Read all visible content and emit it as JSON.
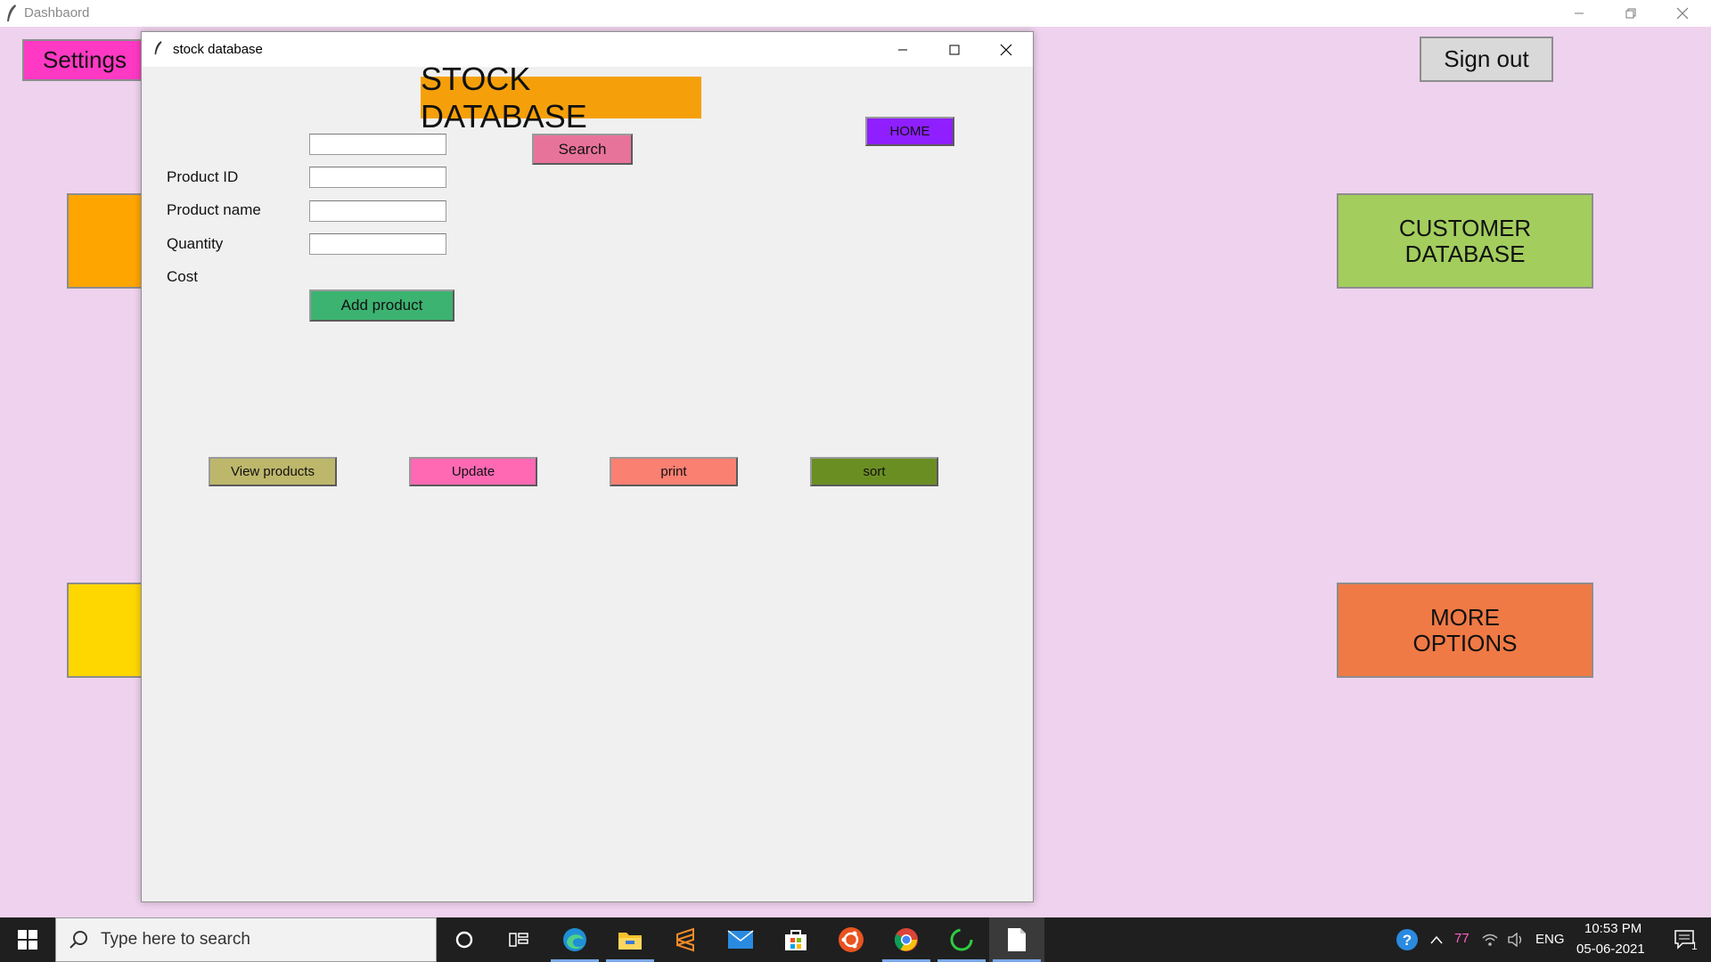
{
  "dashboard": {
    "window_title": "Dashbaord",
    "settings_label": "Settings",
    "signout_label": "Sign out",
    "customer_db_line1": "CUSTOMER",
    "customer_db_line2": "DATABASE",
    "more_options_line1": "MORE",
    "more_options_line2": "OPTIONS"
  },
  "stock_window": {
    "window_title": "stock database",
    "heading": "STOCK DATABASE",
    "fields": {
      "product_id": {
        "label": "Product ID",
        "value": ""
      },
      "product_name": {
        "label": "Product name",
        "value": ""
      },
      "quantity": {
        "label": "Quantity",
        "value": ""
      },
      "cost": {
        "label": "Cost",
        "value": ""
      }
    },
    "buttons": {
      "search": "Search",
      "home": "HOME",
      "add_product": "Add product",
      "view_products": "View products",
      "update": "Update",
      "print": "print",
      "sort": "sort"
    }
  },
  "taskbar": {
    "search_placeholder": "Type here to search",
    "tray_count": "77",
    "language": "ENG",
    "time": "10:53 PM",
    "date": "05-06-2021",
    "notification_count": "1"
  },
  "colors": {
    "dashboard_bg": "#efd2ee",
    "settings": "#ff39c4",
    "customer_db": "#a3cd5d",
    "more_options": "#f07a45",
    "heading_bg": "#f5a00a",
    "search": "#e8739a",
    "home": "#8f1fff",
    "add_product": "#3cb371",
    "view_products": "#bdb76b",
    "update": "#ff69b4",
    "print": "#fa8072",
    "sort": "#6b8e23"
  }
}
